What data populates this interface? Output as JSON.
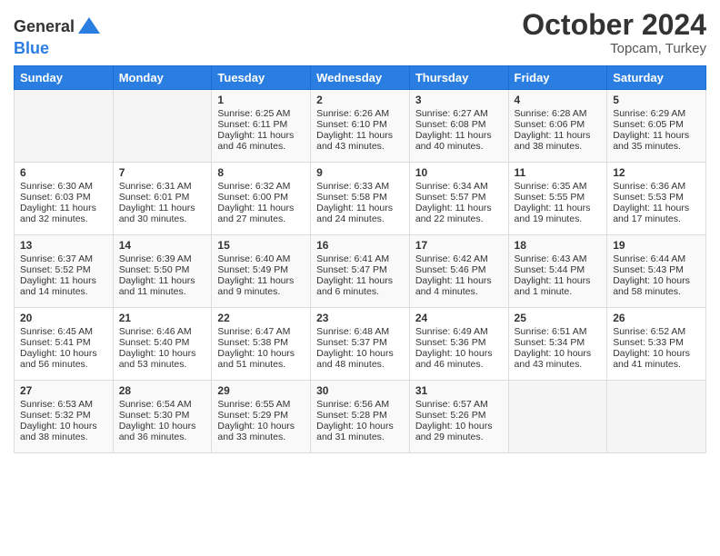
{
  "logo": {
    "general": "General",
    "blue": "Blue"
  },
  "title": "October 2024",
  "location": "Topcam, Turkey",
  "headers": [
    "Sunday",
    "Monday",
    "Tuesday",
    "Wednesday",
    "Thursday",
    "Friday",
    "Saturday"
  ],
  "weeks": [
    [
      {
        "day": "",
        "info": ""
      },
      {
        "day": "",
        "info": ""
      },
      {
        "day": "1",
        "info": "Sunrise: 6:25 AM\nSunset: 6:11 PM\nDaylight: 11 hours and 46 minutes."
      },
      {
        "day": "2",
        "info": "Sunrise: 6:26 AM\nSunset: 6:10 PM\nDaylight: 11 hours and 43 minutes."
      },
      {
        "day": "3",
        "info": "Sunrise: 6:27 AM\nSunset: 6:08 PM\nDaylight: 11 hours and 40 minutes."
      },
      {
        "day": "4",
        "info": "Sunrise: 6:28 AM\nSunset: 6:06 PM\nDaylight: 11 hours and 38 minutes."
      },
      {
        "day": "5",
        "info": "Sunrise: 6:29 AM\nSunset: 6:05 PM\nDaylight: 11 hours and 35 minutes."
      }
    ],
    [
      {
        "day": "6",
        "info": "Sunrise: 6:30 AM\nSunset: 6:03 PM\nDaylight: 11 hours and 32 minutes."
      },
      {
        "day": "7",
        "info": "Sunrise: 6:31 AM\nSunset: 6:01 PM\nDaylight: 11 hours and 30 minutes."
      },
      {
        "day": "8",
        "info": "Sunrise: 6:32 AM\nSunset: 6:00 PM\nDaylight: 11 hours and 27 minutes."
      },
      {
        "day": "9",
        "info": "Sunrise: 6:33 AM\nSunset: 5:58 PM\nDaylight: 11 hours and 24 minutes."
      },
      {
        "day": "10",
        "info": "Sunrise: 6:34 AM\nSunset: 5:57 PM\nDaylight: 11 hours and 22 minutes."
      },
      {
        "day": "11",
        "info": "Sunrise: 6:35 AM\nSunset: 5:55 PM\nDaylight: 11 hours and 19 minutes."
      },
      {
        "day": "12",
        "info": "Sunrise: 6:36 AM\nSunset: 5:53 PM\nDaylight: 11 hours and 17 minutes."
      }
    ],
    [
      {
        "day": "13",
        "info": "Sunrise: 6:37 AM\nSunset: 5:52 PM\nDaylight: 11 hours and 14 minutes."
      },
      {
        "day": "14",
        "info": "Sunrise: 6:39 AM\nSunset: 5:50 PM\nDaylight: 11 hours and 11 minutes."
      },
      {
        "day": "15",
        "info": "Sunrise: 6:40 AM\nSunset: 5:49 PM\nDaylight: 11 hours and 9 minutes."
      },
      {
        "day": "16",
        "info": "Sunrise: 6:41 AM\nSunset: 5:47 PM\nDaylight: 11 hours and 6 minutes."
      },
      {
        "day": "17",
        "info": "Sunrise: 6:42 AM\nSunset: 5:46 PM\nDaylight: 11 hours and 4 minutes."
      },
      {
        "day": "18",
        "info": "Sunrise: 6:43 AM\nSunset: 5:44 PM\nDaylight: 11 hours and 1 minute."
      },
      {
        "day": "19",
        "info": "Sunrise: 6:44 AM\nSunset: 5:43 PM\nDaylight: 10 hours and 58 minutes."
      }
    ],
    [
      {
        "day": "20",
        "info": "Sunrise: 6:45 AM\nSunset: 5:41 PM\nDaylight: 10 hours and 56 minutes."
      },
      {
        "day": "21",
        "info": "Sunrise: 6:46 AM\nSunset: 5:40 PM\nDaylight: 10 hours and 53 minutes."
      },
      {
        "day": "22",
        "info": "Sunrise: 6:47 AM\nSunset: 5:38 PM\nDaylight: 10 hours and 51 minutes."
      },
      {
        "day": "23",
        "info": "Sunrise: 6:48 AM\nSunset: 5:37 PM\nDaylight: 10 hours and 48 minutes."
      },
      {
        "day": "24",
        "info": "Sunrise: 6:49 AM\nSunset: 5:36 PM\nDaylight: 10 hours and 46 minutes."
      },
      {
        "day": "25",
        "info": "Sunrise: 6:51 AM\nSunset: 5:34 PM\nDaylight: 10 hours and 43 minutes."
      },
      {
        "day": "26",
        "info": "Sunrise: 6:52 AM\nSunset: 5:33 PM\nDaylight: 10 hours and 41 minutes."
      }
    ],
    [
      {
        "day": "27",
        "info": "Sunrise: 6:53 AM\nSunset: 5:32 PM\nDaylight: 10 hours and 38 minutes."
      },
      {
        "day": "28",
        "info": "Sunrise: 6:54 AM\nSunset: 5:30 PM\nDaylight: 10 hours and 36 minutes."
      },
      {
        "day": "29",
        "info": "Sunrise: 6:55 AM\nSunset: 5:29 PM\nDaylight: 10 hours and 33 minutes."
      },
      {
        "day": "30",
        "info": "Sunrise: 6:56 AM\nSunset: 5:28 PM\nDaylight: 10 hours and 31 minutes."
      },
      {
        "day": "31",
        "info": "Sunrise: 6:57 AM\nSunset: 5:26 PM\nDaylight: 10 hours and 29 minutes."
      },
      {
        "day": "",
        "info": ""
      },
      {
        "day": "",
        "info": ""
      }
    ]
  ]
}
